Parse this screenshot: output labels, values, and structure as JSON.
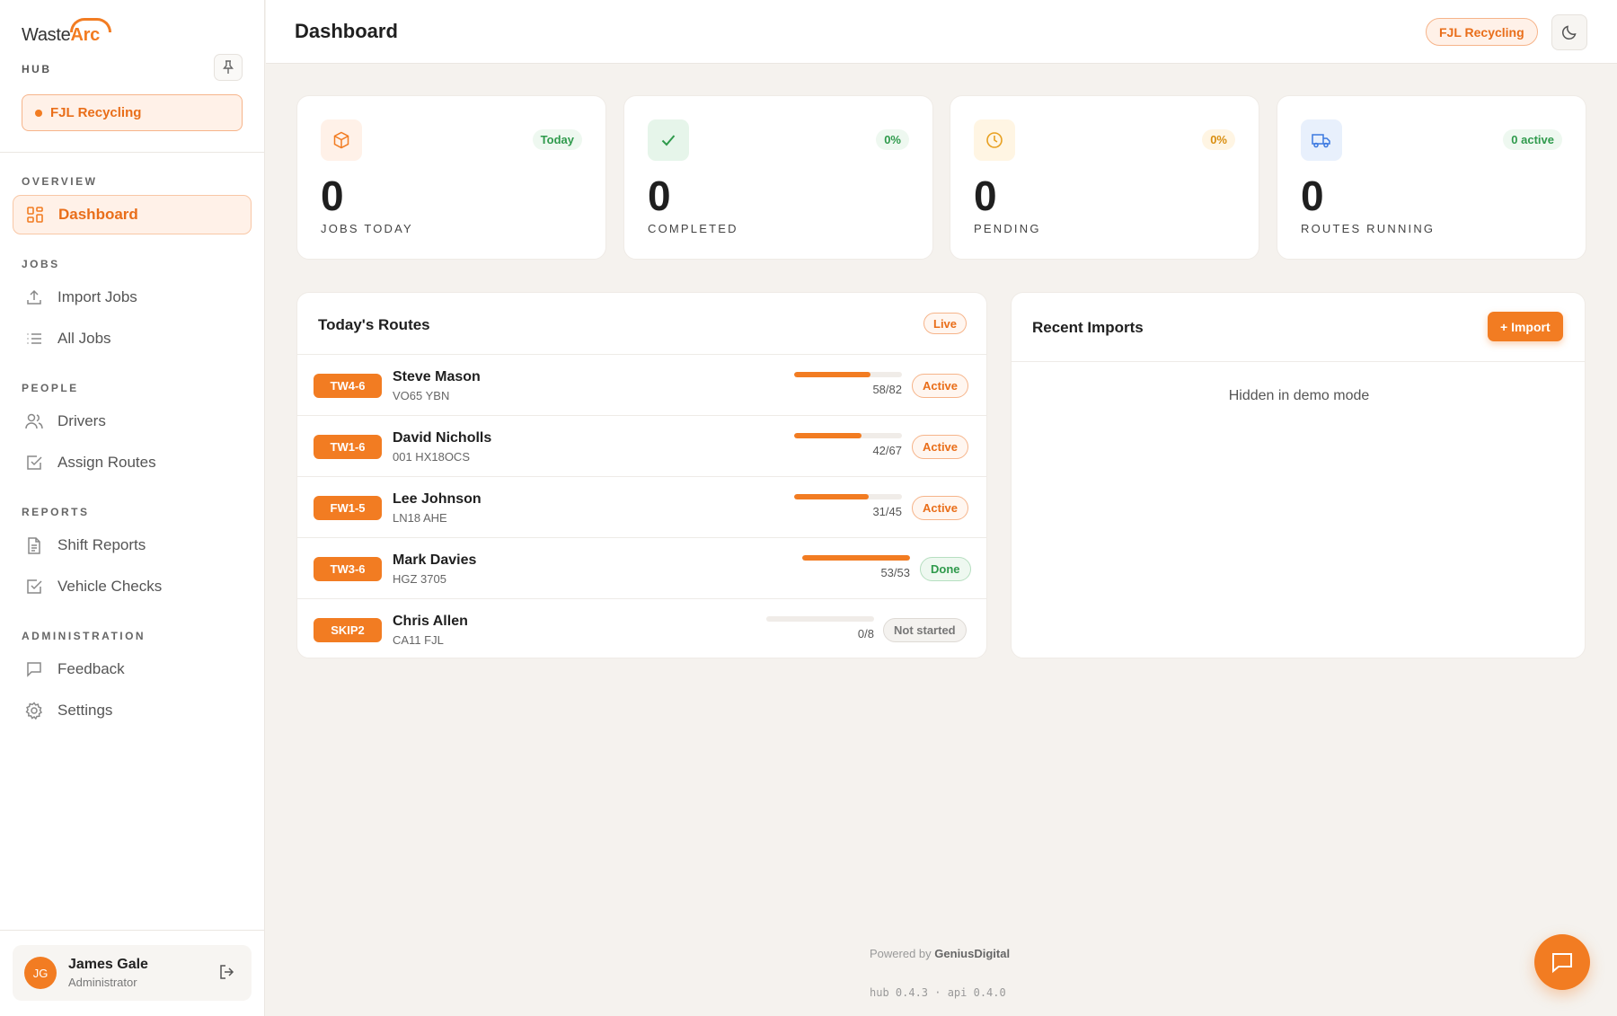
{
  "brand": {
    "logo_prefix": "Waste",
    "logo_accent": "Arc",
    "hub_label": "HUB",
    "accent": "#f27c22"
  },
  "org": {
    "name": "FJL Recycling"
  },
  "sidebar": {
    "sections": [
      {
        "label": "OVERVIEW"
      },
      {
        "label": "JOBS"
      },
      {
        "label": "PEOPLE"
      },
      {
        "label": "REPORTS"
      },
      {
        "label": "ADMINISTRATION"
      }
    ],
    "items": [
      {
        "label": "Dashboard",
        "icon": "dashboard-grid-icon",
        "active": true
      },
      {
        "label": "Import Jobs",
        "icon": "upload-icon"
      },
      {
        "label": "All Jobs",
        "icon": "list-icon"
      },
      {
        "label": "Drivers",
        "icon": "users-icon"
      },
      {
        "label": "Assign Routes",
        "icon": "checkbox-icon"
      },
      {
        "label": "Shift Reports",
        "icon": "document-icon"
      },
      {
        "label": "Vehicle Checks",
        "icon": "checkbox-icon"
      },
      {
        "label": "Feedback",
        "icon": "message-icon"
      },
      {
        "label": "Settings",
        "icon": "gear-icon"
      }
    ]
  },
  "user": {
    "initials": "JG",
    "name": "James Gale",
    "role": "Administrator"
  },
  "header": {
    "title": "Dashboard",
    "org_badge": "FJL Recycling"
  },
  "stats": [
    {
      "value": "0",
      "label": "JOBS TODAY",
      "tag": "Today",
      "icon": "box-icon"
    },
    {
      "value": "0",
      "label": "COMPLETED",
      "tag": "0%",
      "icon": "check-icon"
    },
    {
      "value": "0",
      "label": "PENDING",
      "tag": "0%",
      "icon": "clock-icon"
    },
    {
      "value": "0",
      "label": "ROUTES RUNNING",
      "tag": "0 active",
      "icon": "truck-icon"
    }
  ],
  "routes": {
    "title": "Today's Routes",
    "badge": "Live",
    "rows": [
      {
        "code": "TW4-6",
        "driver": "Steve Mason",
        "plate": "VO65 YBN",
        "done": 58,
        "total": 82,
        "count": "58/82",
        "status": "Active"
      },
      {
        "code": "TW1-6",
        "driver": "David Nicholls",
        "plate": "001 HX18OCS",
        "done": 42,
        "total": 67,
        "count": "42/67",
        "status": "Active"
      },
      {
        "code": "FW1-5",
        "driver": "Lee Johnson",
        "plate": "LN18 AHE",
        "done": 31,
        "total": 45,
        "count": "31/45",
        "status": "Active"
      },
      {
        "code": "TW3-6",
        "driver": "Mark Davies",
        "plate": "HGZ 3705",
        "done": 53,
        "total": 53,
        "count": "53/53",
        "status": "Done"
      },
      {
        "code": "SKIP2",
        "driver": "Chris Allen",
        "plate": "CA11 FJL",
        "done": 0,
        "total": 8,
        "count": "0/8",
        "status": "Not started"
      }
    ]
  },
  "imports": {
    "title": "Recent Imports",
    "button": "+ Import",
    "empty": "Hidden in demo mode"
  },
  "footer": {
    "powered_prefix": "Powered by",
    "powered_brand": "GeniusDigital",
    "versions": "hub 0.4.3 · api 0.4.0"
  }
}
